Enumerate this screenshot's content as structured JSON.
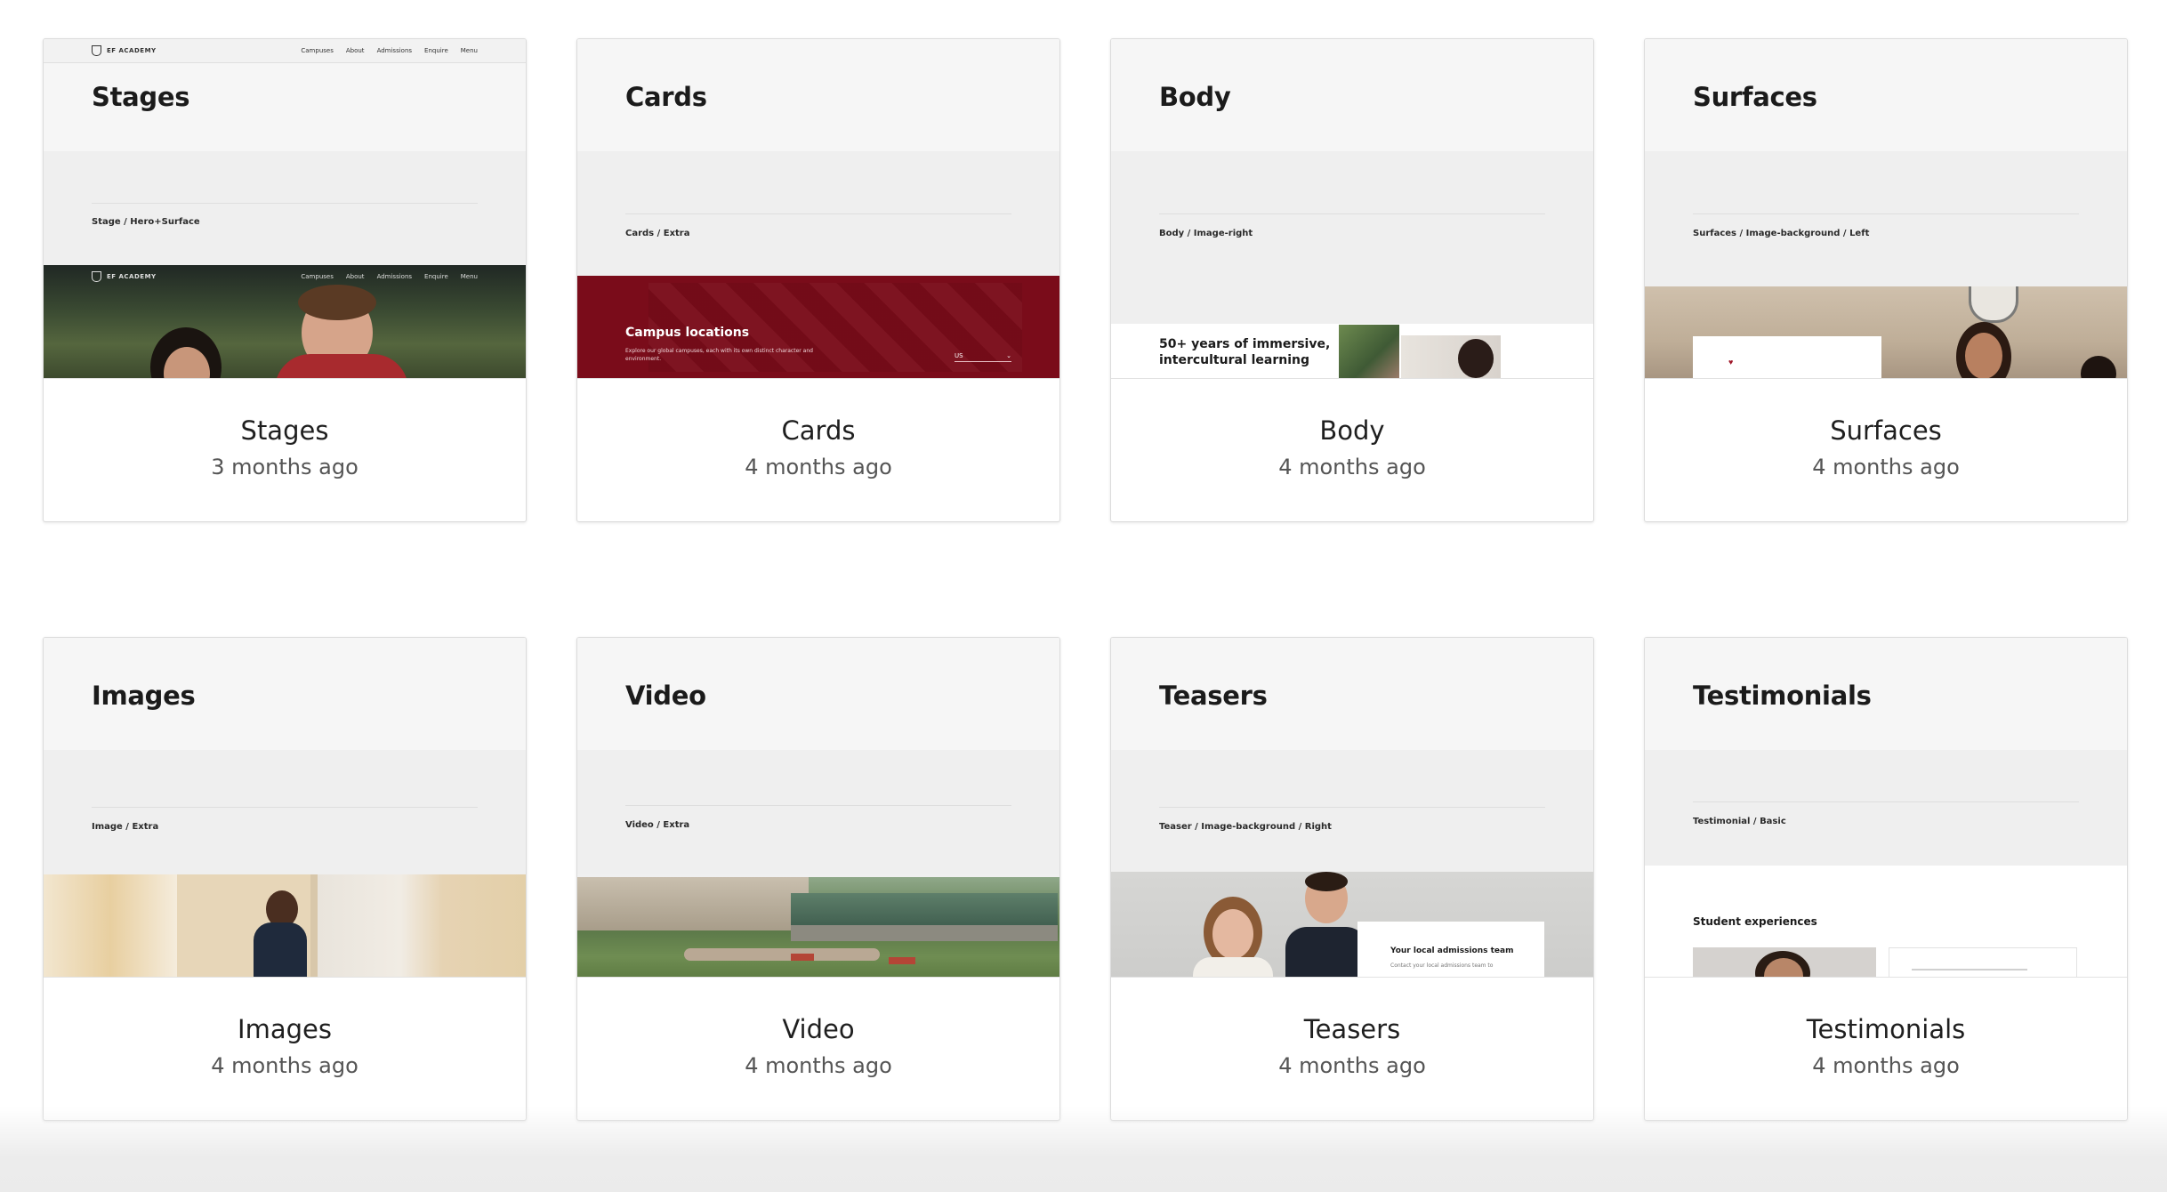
{
  "cards": [
    {
      "name": "Stages",
      "date": "3 months ago",
      "preview": {
        "heading": "Stages",
        "path": "Stage / Hero+Surface",
        "brand": "EF ACADEMY",
        "nav_links": [
          "Campuses",
          "About",
          "Admissions",
          "Enquire",
          "Menu"
        ]
      }
    },
    {
      "name": "Cards",
      "date": "4 months ago",
      "preview": {
        "heading": "Cards",
        "path": "Cards / Extra",
        "banner_title": "Campus locations",
        "banner_text": "Explore our global campuses, each with its own distinct character and environment.",
        "select_value": "US"
      }
    },
    {
      "name": "Body",
      "date": "4 months ago",
      "preview": {
        "heading": "Body",
        "path": "Body / Image-right",
        "body_text_1": "50+ years of immersive,",
        "body_text_2": "intercultural learning"
      }
    },
    {
      "name": "Surfaces",
      "date": "4 months ago",
      "preview": {
        "heading": "Surfaces",
        "path": "Surfaces / Image-background / Left"
      }
    },
    {
      "name": "Images",
      "date": "4 months ago",
      "preview": {
        "heading": "Images",
        "path": "Image / Extra"
      }
    },
    {
      "name": "Video",
      "date": "4 months ago",
      "preview": {
        "heading": "Video",
        "path": "Video / Extra"
      }
    },
    {
      "name": "Teasers",
      "date": "4 months ago",
      "preview": {
        "heading": "Teasers",
        "path": "Teaser / Image-background / Right",
        "overlay_title": "Your local admissions team",
        "overlay_text": "Contact your local admissions team to"
      }
    },
    {
      "name": "Testimonials",
      "date": "4 months ago",
      "preview": {
        "heading": "Testimonials",
        "path": "Testimonial / Basic",
        "section_title": "Student experiences"
      }
    }
  ],
  "colors": {
    "brand_red": "#7a0c1a",
    "card_border": "#dcdcdc",
    "background": "#ffffff"
  }
}
